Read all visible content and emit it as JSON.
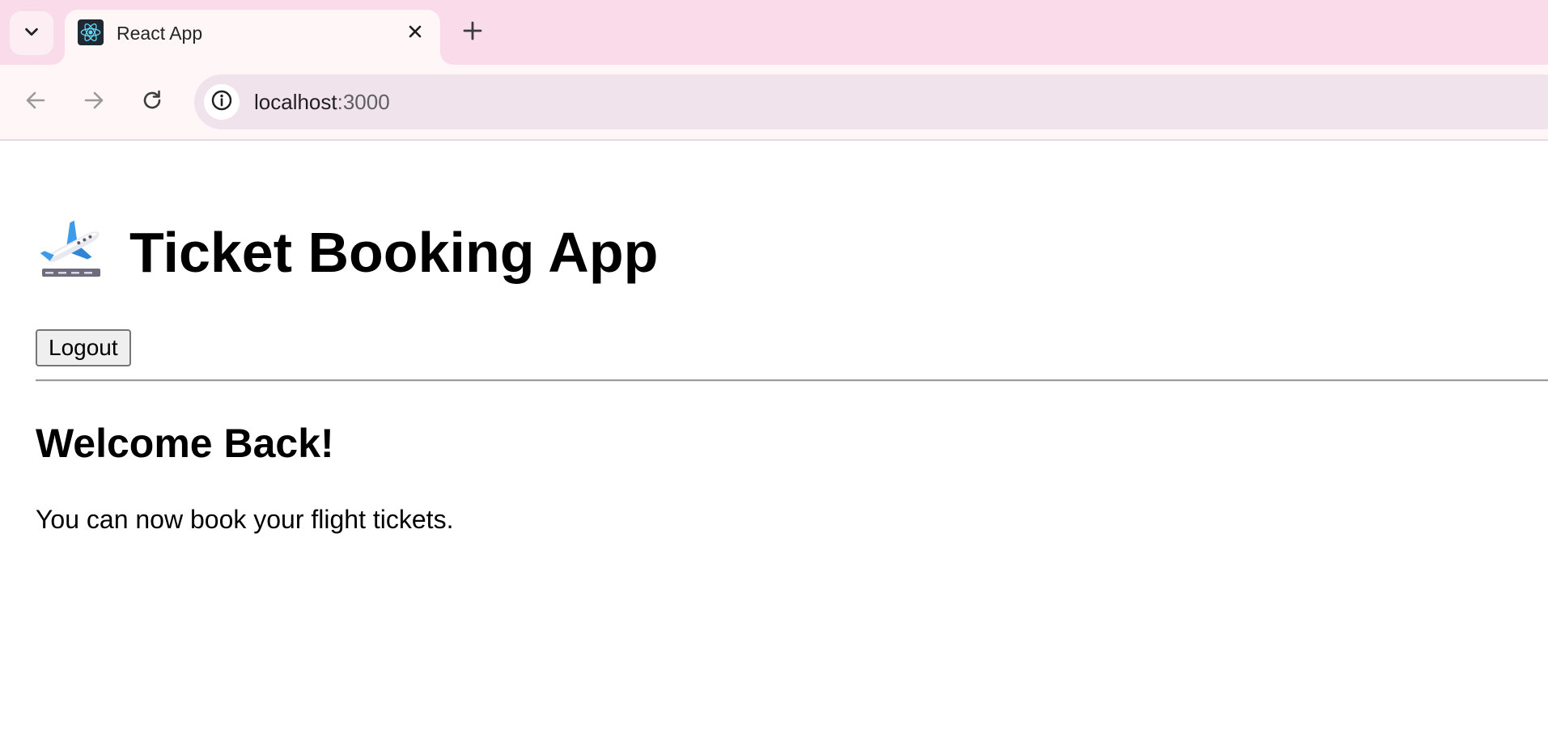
{
  "browser": {
    "tab": {
      "title": "React App",
      "favicon": "react-logo-icon"
    },
    "address_bar": {
      "host": "localhost",
      "port": ":3000"
    },
    "icons": {
      "tab_search": "chevron-down-icon",
      "close_tab": "close-icon",
      "new_tab": "plus-icon",
      "back": "arrow-left-icon",
      "forward": "arrow-right-icon",
      "reload": "reload-icon",
      "site_info": "info-icon"
    },
    "colors": {
      "tab_strip": "#f9dbe9",
      "toolbar": "#fff6f8",
      "omnibox": "#f1e3ec"
    }
  },
  "page": {
    "emoji": "airplane-departure-icon",
    "heading": "Ticket Booking App",
    "logout_label": "Logout",
    "welcome_heading": "Welcome Back!",
    "welcome_text": "You can now book your flight tickets."
  }
}
